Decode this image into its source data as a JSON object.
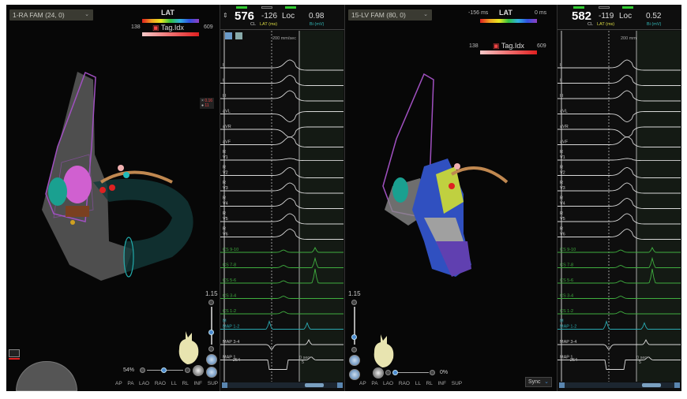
{
  "left_map": {
    "dropdown": "1-RA FAM (24, 0)",
    "lat_label": "LAT",
    "tag_label": "Tag.Idx",
    "tag_min": "138",
    "tag_max": "609",
    "zoom": "1.15",
    "rotation_pct": "54%",
    "legend_small": [
      "0.16",
      "11"
    ]
  },
  "left_ecg": {
    "cl": "576",
    "cl_label": "CL",
    "lat": "-126",
    "lat_label": "LAT (ms)",
    "loc": "Loc",
    "bi": "0.98",
    "bi_label": "Bi (mV)",
    "speed": "200 mm/sec",
    "map1_value": "-264",
    "time_label": "0 sec",
    "time_value": "5"
  },
  "right_map": {
    "dropdown": "15-LV FAM (80, 0)",
    "lat_label": "LAT",
    "lat_min": "-156 ms",
    "lat_max": "0 ms",
    "tag_label": "Tag.Idx",
    "tag_min": "138",
    "tag_max": "609",
    "zoom": "1.15",
    "rotation_pct": "0%",
    "sync": "Sync"
  },
  "right_ecg": {
    "cl": "582",
    "cl_label": "CL",
    "lat": "-119",
    "lat_label": "LAT (ms)",
    "loc": "Loc",
    "bi": "0.52",
    "bi_label": "Bi (mV)",
    "speed": "200 mm/sec",
    "map1_value": "-264",
    "time_label": "0 sec",
    "time_value": "5"
  },
  "view_buttons": [
    "AP",
    "PA",
    "LAO",
    "RAO",
    "LL",
    "RL",
    "INF",
    "SUP"
  ],
  "channels": [
    {
      "prefix": "",
      "label": "I",
      "color": "#d8d8d8"
    },
    {
      "prefix": "",
      "label": "II",
      "color": "#d8d8d8"
    },
    {
      "prefix": "",
      "label": "III",
      "color": "#d8d8d8"
    },
    {
      "prefix": "",
      "label": "aVL",
      "color": "#d8d8d8"
    },
    {
      "prefix": "",
      "label": "aVR",
      "color": "#d8d8d8"
    },
    {
      "prefix": "",
      "label": "aVF",
      "color": "#d8d8d8"
    },
    {
      "prefix": "R",
      "label": "V1",
      "color": "#d8d8d8"
    },
    {
      "prefix": "R",
      "label": "V2",
      "color": "#d8d8d8"
    },
    {
      "prefix": "R",
      "label": "V3",
      "color": "#d8d8d8"
    },
    {
      "prefix": "R",
      "label": "V4",
      "color": "#d8d8d8"
    },
    {
      "prefix": "R",
      "label": "V5",
      "color": "#d8d8d8"
    },
    {
      "prefix": "R",
      "label": "V6",
      "color": "#d8d8d8"
    },
    {
      "prefix": "",
      "label": "CS 9-10",
      "color": "#3fae3f"
    },
    {
      "prefix": "",
      "label": "CS 7-8",
      "color": "#3fae3f"
    },
    {
      "prefix": "",
      "label": "CS 5-6",
      "color": "#3fae3f"
    },
    {
      "prefix": "",
      "label": "CS 3-4",
      "color": "#3fae3f"
    },
    {
      "prefix": "",
      "label": "CS 1-2",
      "color": "#3fae3f"
    },
    {
      "prefix": "M",
      "label": "MAP 1-2",
      "color": "#2aa8b0"
    },
    {
      "prefix": "",
      "label": "MAP 3-4",
      "color": "#d8d8d8"
    },
    {
      "prefix": "",
      "label": "MAP 1",
      "color": "#d8d8d8"
    }
  ],
  "colors": {
    "accent": "#4a8ad0",
    "cs": "#3fae3f",
    "map": "#2aa8b0",
    "mesh": "#a050c0"
  }
}
